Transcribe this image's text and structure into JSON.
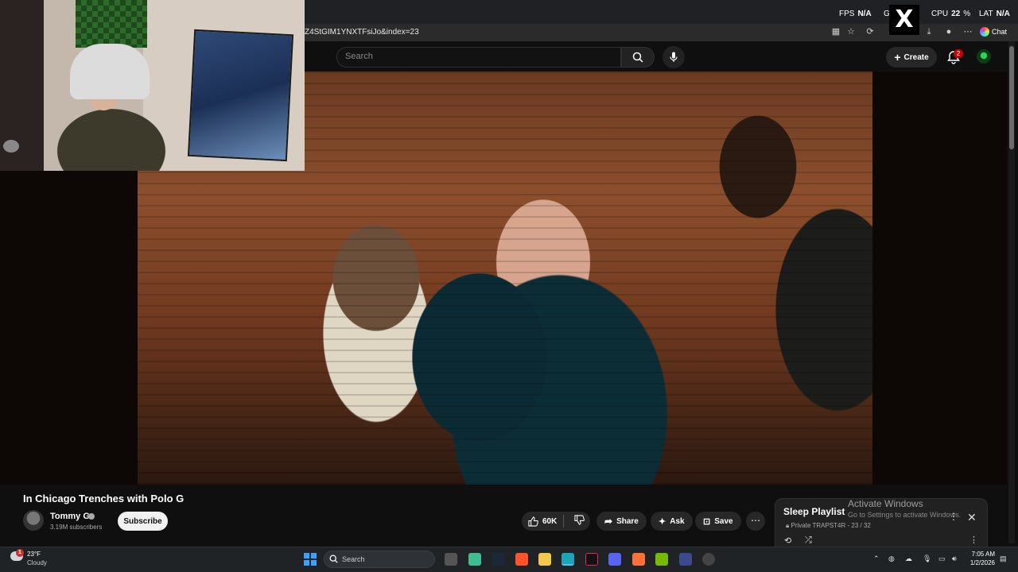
{
  "browser": {
    "url": "Z4StGIM1YNXTFsiJo&index=23",
    "chat_label": "Chat"
  },
  "perf_overlay": {
    "fps_label": "FPS",
    "fps_value": "N/A",
    "gpu_label": "G",
    "cpu_label": "CPU",
    "cpu_value": "22",
    "cpu_unit": "%",
    "lat_label": "LAT",
    "lat_value": "N/A"
  },
  "header": {
    "search_placeholder": "Search",
    "create_label": "Create",
    "notification_count": "2"
  },
  "video": {
    "title": "In Chicago Trenches with Polo G",
    "channel_name": "Tommy G",
    "subscribers": "3.19M subscribers",
    "subscribe_label": "Subscribe",
    "likes": "60K",
    "share_label": "Share",
    "ask_label": "Ask",
    "save_label": "Save"
  },
  "playlist": {
    "title": "Sleep Playlist",
    "meta": "Private TRAPST4R - 23 / 32"
  },
  "watermark": {
    "title": "Activate Windows",
    "subtitle": "Go to Settings to activate Windows."
  },
  "taskbar": {
    "weather_alert": "1",
    "temperature": "23°F",
    "condition": "Cloudy",
    "search_label": "Search",
    "time": "7:05 AM",
    "date": "1/2/2026"
  }
}
